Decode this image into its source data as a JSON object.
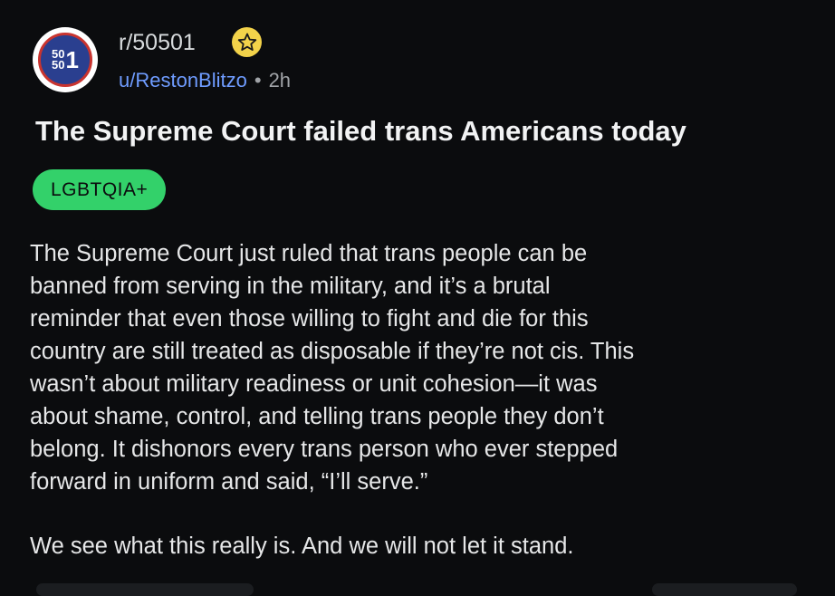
{
  "post": {
    "avatar": {
      "small_text_top": "50",
      "small_text_bottom": "50",
      "big_text": "1"
    },
    "subreddit": "r/50501",
    "username": "u/RestonBlitzo",
    "separator": "•",
    "time": "2h",
    "title": "The Supreme Court failed trans Americans today",
    "flair": "LGBTQIA+",
    "body_lines_p1": [
      "The Supreme Court just ruled that trans people can be",
      "banned from serving in the military, and it’s a brutal",
      "reminder that even those willing to fight and die for this",
      "country are still treated as disposable if they’re not cis. This",
      "wasn’t about military readiness or unit cohesion—it was",
      "about shame, control, and telling trans people they don’t",
      "belong. It dishonors every trans person who ever stepped",
      "forward in uniform and said, “I’ll serve.”"
    ],
    "body_p2": "We see what this really is. And we will not let it stand."
  },
  "colors": {
    "background": "#0b0c0e",
    "username": "#6f9cff",
    "flair_bg": "#33d16a",
    "badge": "#f3d34a"
  },
  "icons": {
    "badge": "star-badge-icon"
  }
}
